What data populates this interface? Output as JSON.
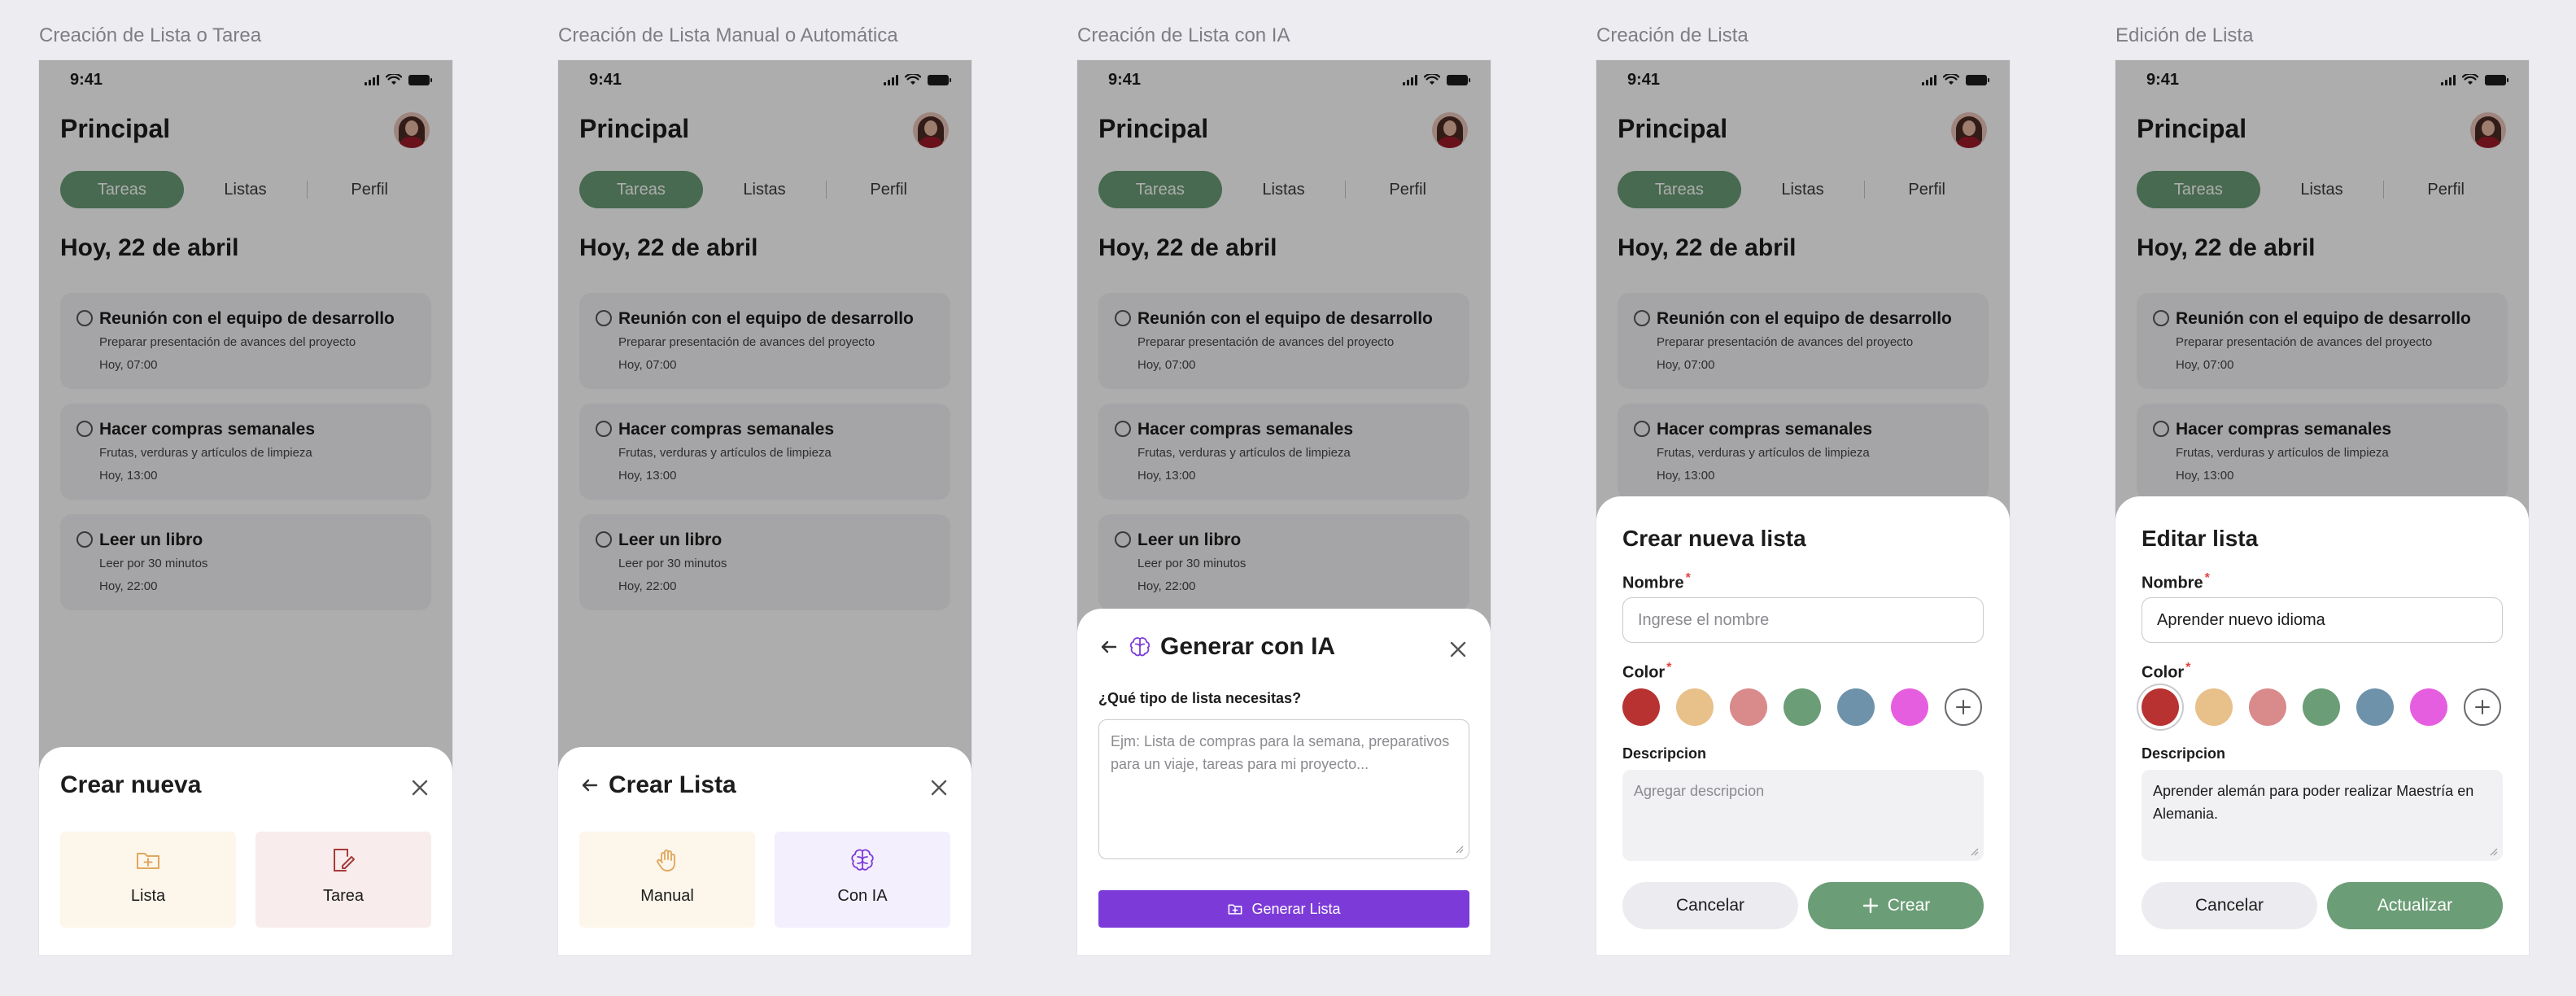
{
  "colors": {
    "accent": "#6b9d76",
    "ai_purple": "#7c3bd9",
    "list_card_bg": "#fdf6ea",
    "task_card_bg": "#f8ecec",
    "ai_card_bg": "#f3effd",
    "required": "#e04444"
  },
  "status_bar": {
    "time": "9:41"
  },
  "app": {
    "title": "Principal"
  },
  "tabs": [
    {
      "label": "Tareas",
      "active": true
    },
    {
      "label": "Listas",
      "active": false
    },
    {
      "label": "Perfil",
      "active": false
    }
  ],
  "date_heading": "Hoy, 22 de abril",
  "tasks": [
    {
      "title": "Reunión con el equipo de desarrollo",
      "description": "Preparar presentación de avances del proyecto",
      "time": "Hoy, 07:00"
    },
    {
      "title": "Hacer compras semanales",
      "description": "Frutas, verduras y artículos de limpieza",
      "time": "Hoy, 13:00"
    },
    {
      "title": "Leer un libro",
      "description": "Leer por 30 minutos",
      "time": "Hoy, 22:00"
    }
  ],
  "screens": {
    "crear_nueva": {
      "caption": "Creación de Lista o Tarea",
      "sheet_title": "Crear nueva",
      "options": [
        {
          "label": "Lista",
          "icon": "folder-plus-icon"
        },
        {
          "label": "Tarea",
          "icon": "note-edit-icon"
        }
      ]
    },
    "crear_lista_tipo": {
      "caption": "Creación de Lista Manual o Automática",
      "sheet_title": "Crear Lista",
      "options": [
        {
          "label": "Manual",
          "icon": "hand-icon"
        },
        {
          "label": "Con IA",
          "icon": "brain-icon"
        }
      ]
    },
    "generar_ia": {
      "caption": "Creación de Lista con IA",
      "sheet_title": "Generar con IA",
      "question": "¿Qué tipo de lista necesitas?",
      "prompt_placeholder": "Ejm: Lista de compras para la semana, preparativos para un viaje, tareas para mi proyecto...",
      "generate_label": "Generar Lista"
    },
    "crear_lista": {
      "caption": "Creación de Lista",
      "sheet_title": "Crear nueva lista",
      "name_label": "Nombre",
      "name_placeholder": "Ingrese el nombre",
      "color_label": "Color",
      "description_label": "Descripcion",
      "description_placeholder": "Agregar descripcion",
      "cancel_label": "Cancelar",
      "submit_label": "Crear"
    },
    "editar_lista": {
      "caption": "Edición de Lista",
      "sheet_title": "Editar lista",
      "name_label": "Nombre",
      "name_value": "Aprender nuevo idioma",
      "color_label": "Color",
      "selected_color": "#b83232",
      "description_label": "Descripcion",
      "description_value": "Aprender alemán para poder realizar Maestría en Alemania.",
      "cancel_label": "Cancelar",
      "submit_label": "Actualizar"
    }
  },
  "palette": [
    "#b83232",
    "#e8c08a",
    "#d98a8a",
    "#6b9d76",
    "#6e92aa",
    "#e65ee0"
  ]
}
